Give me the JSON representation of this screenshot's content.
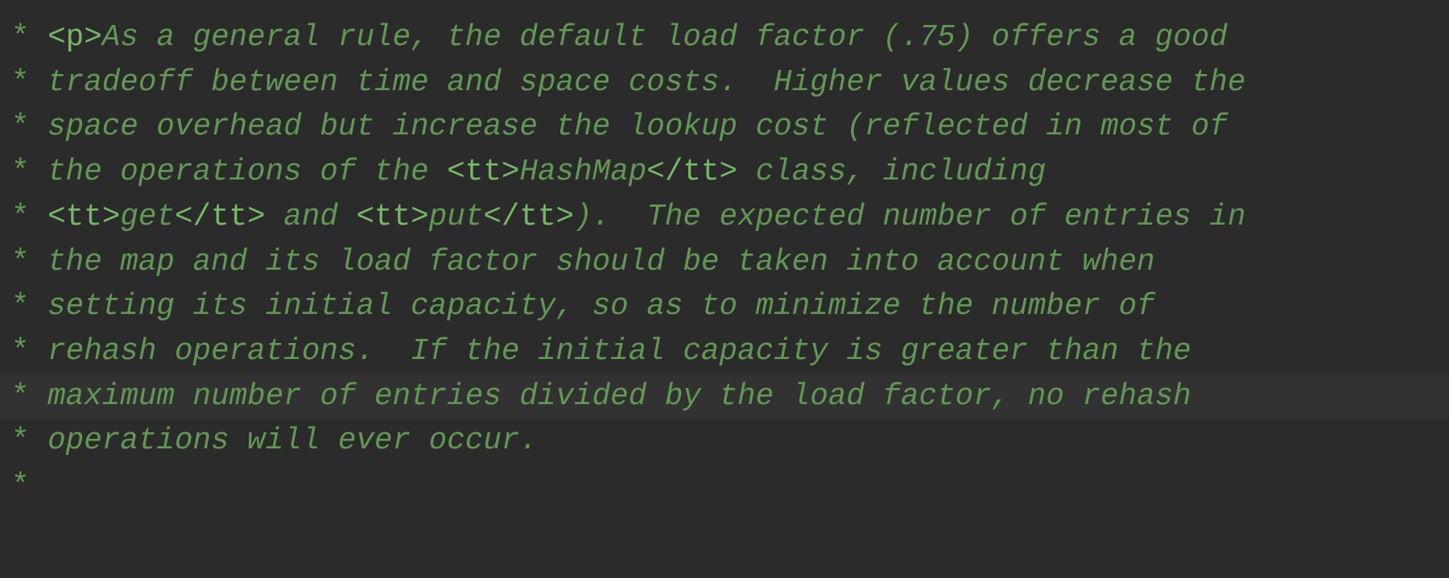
{
  "editor": {
    "comment_color": "#629755",
    "tag_color": "#77b767",
    "background": "#2b2b2b",
    "current_line_background": "#323232",
    "current_line_index": 8,
    "lines": [
      {
        "segments": [
          {
            "t": "* ",
            "k": "star"
          },
          {
            "t": "<p>",
            "k": "tag"
          },
          {
            "t": "As a general rule, the default load factor (.75) offers a good",
            "k": "text"
          }
        ]
      },
      {
        "segments": [
          {
            "t": "* ",
            "k": "star"
          },
          {
            "t": "tradeoff between time and space costs.  Higher values decrease the",
            "k": "text"
          }
        ]
      },
      {
        "segments": [
          {
            "t": "* ",
            "k": "star"
          },
          {
            "t": "space overhead but increase the lookup cost (reflected in most of",
            "k": "text"
          }
        ]
      },
      {
        "segments": [
          {
            "t": "* ",
            "k": "star"
          },
          {
            "t": "the operations of the ",
            "k": "text"
          },
          {
            "t": "<tt>",
            "k": "tag"
          },
          {
            "t": "HashMap",
            "k": "text"
          },
          {
            "t": "</tt>",
            "k": "tag"
          },
          {
            "t": " class, including",
            "k": "text"
          }
        ]
      },
      {
        "segments": [
          {
            "t": "* ",
            "k": "star"
          },
          {
            "t": "<tt>",
            "k": "tag"
          },
          {
            "t": "get",
            "k": "text"
          },
          {
            "t": "</tt>",
            "k": "tag"
          },
          {
            "t": " and ",
            "k": "text"
          },
          {
            "t": "<tt>",
            "k": "tag"
          },
          {
            "t": "put",
            "k": "text"
          },
          {
            "t": "</tt>",
            "k": "tag"
          },
          {
            "t": ").  The expected number of entries in",
            "k": "text"
          }
        ]
      },
      {
        "segments": [
          {
            "t": "* ",
            "k": "star"
          },
          {
            "t": "the map and its load factor should be taken into account when",
            "k": "text"
          }
        ]
      },
      {
        "segments": [
          {
            "t": "* ",
            "k": "star"
          },
          {
            "t": "setting its initial capacity, so as to minimize the number of",
            "k": "text"
          }
        ]
      },
      {
        "segments": [
          {
            "t": "* ",
            "k": "star"
          },
          {
            "t": "rehash operations.  If the initial capacity is greater than the",
            "k": "text"
          }
        ]
      },
      {
        "segments": [
          {
            "t": "* ",
            "k": "star"
          },
          {
            "t": "maximum number of entries divided by the load factor, no rehash",
            "k": "text"
          }
        ]
      },
      {
        "segments": [
          {
            "t": "* ",
            "k": "star"
          },
          {
            "t": "operations will ever occur.",
            "k": "text"
          }
        ]
      },
      {
        "segments": [
          {
            "t": "*",
            "k": "star"
          }
        ]
      }
    ]
  }
}
